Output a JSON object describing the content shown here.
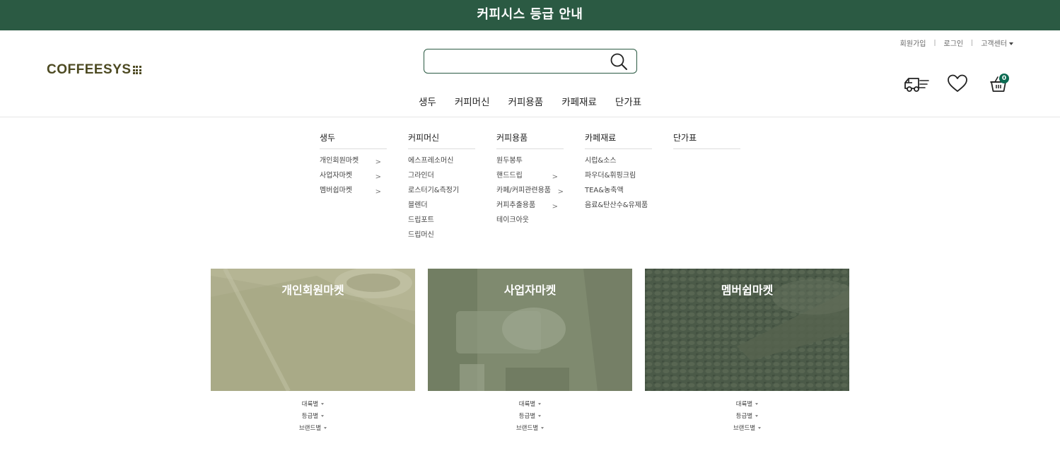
{
  "banner": {
    "text": "커피시스 등급 안내"
  },
  "header": {
    "logo_text": "COFFEESYS",
    "search": {
      "value": "",
      "placeholder": ""
    },
    "util_links": [
      "회원가입",
      "로그인",
      "고객센터"
    ],
    "cart_count": "0"
  },
  "icons": [
    "search-icon",
    "delivery-truck-icon",
    "heart-icon",
    "basket-icon",
    "chevron-right-icon",
    "caret-down-icon"
  ],
  "mainnav": [
    "생두",
    "커피머신",
    "커피용품",
    "카페재료",
    "단가표"
  ],
  "megamenu": [
    {
      "title": "생두",
      "items": [
        {
          "label": "개인회원마켓",
          "arrow": true
        },
        {
          "label": "사업자마켓",
          "arrow": true
        },
        {
          "label": "멤버쉽마켓",
          "arrow": true
        }
      ]
    },
    {
      "title": "커피머신",
      "items": [
        {
          "label": "에스프레소머신",
          "arrow": false
        },
        {
          "label": "그라인더",
          "arrow": false
        },
        {
          "label": "로스터기&측정기",
          "arrow": false
        },
        {
          "label": "블렌더",
          "arrow": false
        },
        {
          "label": "드립포트",
          "arrow": false
        },
        {
          "label": "드립머신",
          "arrow": false
        }
      ]
    },
    {
      "title": "커피용품",
      "items": [
        {
          "label": "원두봉투",
          "arrow": false
        },
        {
          "label": "핸드드립",
          "arrow": true
        },
        {
          "label": "카페/커피관련용품",
          "arrow": true
        },
        {
          "label": "커피추출용품",
          "arrow": true
        },
        {
          "label": "테이크아웃",
          "arrow": false
        }
      ]
    },
    {
      "title": "카페재료",
      "items": [
        {
          "label": "시럽&소스",
          "arrow": false
        },
        {
          "label": "파우더&휘핑크림",
          "arrow": false
        },
        {
          "label": "TEA&농축액",
          "arrow": false
        },
        {
          "label": "음료&탄산수&유제품",
          "arrow": false
        }
      ]
    },
    {
      "title": "단가표",
      "items": []
    }
  ],
  "cards": [
    {
      "title": "개인회원마켓",
      "color": "#aeae8d",
      "links": [
        "대륙별",
        "등급별",
        "브랜드별"
      ]
    },
    {
      "title": "사업자마켓",
      "color": "#7f8a6f",
      "links": [
        "대륙별",
        "등급별",
        "브랜드별"
      ]
    },
    {
      "title": "멤버쉽마켓",
      "color": "#4b5a48",
      "links": [
        "대륙별",
        "등급별",
        "브랜드별"
      ]
    }
  ],
  "colors": {
    "brand_green": "#2b5a43",
    "logo_olive": "#4d4a22",
    "badge_green": "#0c6b52"
  }
}
